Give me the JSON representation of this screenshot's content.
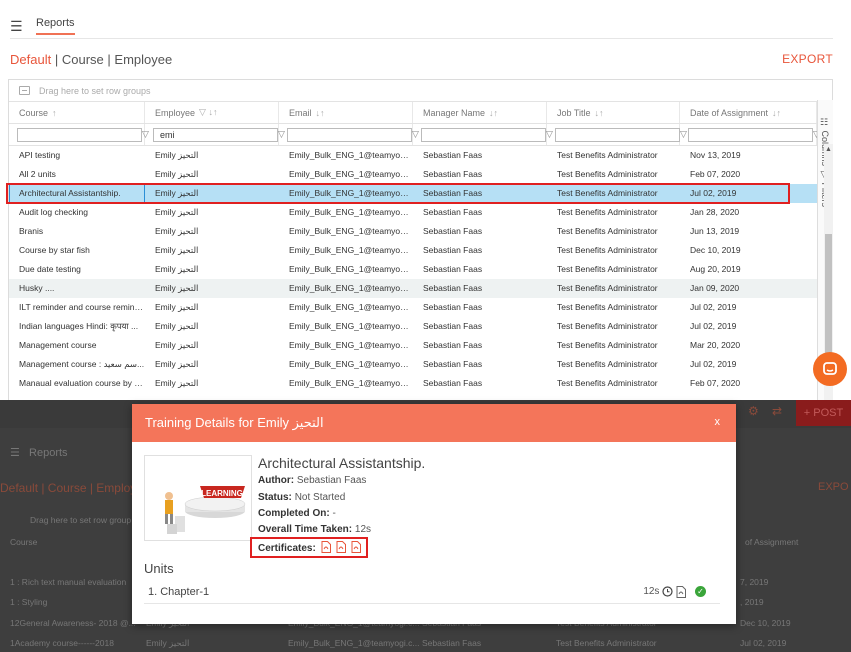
{
  "header": {
    "title": "Reports"
  },
  "breadcrumb": {
    "active": "Default",
    "sep1": "|",
    "course": "Course",
    "sep2": "|",
    "employee": "Employee"
  },
  "export_label": "EXPORT",
  "grid": {
    "group_hint": "Drag here to set row groups",
    "columns": [
      {
        "label": "Course",
        "sort": "↑"
      },
      {
        "label": "Employee",
        "sort": "▽ ↓↑"
      },
      {
        "label": "Email",
        "sort": "↓↑"
      },
      {
        "label": "Manager Name",
        "sort": "↓↑"
      },
      {
        "label": "Job Title",
        "sort": "↓↑"
      },
      {
        "label": "Date of Assignment",
        "sort": "↓↑"
      }
    ],
    "filters": [
      "",
      "emi",
      "",
      "",
      "",
      ""
    ],
    "rows": [
      [
        "API testing",
        "Emily التحيز",
        "Emily_Bulk_ENG_1@teamyogi.c...",
        "Sebastian Faas",
        "Test Benefits Administrator",
        "Nov 13, 2019"
      ],
      [
        "All 2 units",
        "Emily التحيز",
        "Emily_Bulk_ENG_1@teamyogi.c...",
        "Sebastian Faas",
        "Test Benefits Administrator",
        "Feb 07, 2020"
      ],
      [
        "Architectural Assistantship.",
        "Emily التحيز",
        "Emily_Bulk_ENG_1@teamyogi.c...",
        "Sebastian Faas",
        "Test Benefits Administrator",
        "Jul 02, 2019"
      ],
      [
        "Audit log checking",
        "Emily التحيز",
        "Emily_Bulk_ENG_1@teamyogi.c...",
        "Sebastian Faas",
        "Test Benefits Administrator",
        "Jan 28, 2020"
      ],
      [
        "Branis",
        "Emily التحيز",
        "Emily_Bulk_ENG_1@teamyogi.c...",
        "Sebastian Faas",
        "Test Benefits Administrator",
        "Jun 13, 2019"
      ],
      [
        "Course by star fish",
        "Emily التحيز",
        "Emily_Bulk_ENG_1@teamyogi.c...",
        "Sebastian Faas",
        "Test Benefits Administrator",
        "Dec 10, 2019"
      ],
      [
        "Due date testing",
        "Emily التحيز",
        "Emily_Bulk_ENG_1@teamyogi.c...",
        "Sebastian Faas",
        "Test Benefits Administrator",
        "Aug 20, 2019"
      ],
      [
        "Husky ....",
        "Emily التحيز",
        "Emily_Bulk_ENG_1@teamyogi.c...",
        "Sebastian Faas",
        "Test Benefits Administrator",
        "Jan 09, 2020"
      ],
      [
        "ILT reminder and course remind...",
        "Emily التحيز",
        "Emily_Bulk_ENG_1@teamyogi.c...",
        "Sebastian Faas",
        "Test Benefits Administrator",
        "Jul 02, 2019"
      ],
      [
        "Indian languages Hindi: कृपया ...",
        "Emily التحيز",
        "Emily_Bulk_ENG_1@teamyogi.c...",
        "Sebastian Faas",
        "Test Benefits Administrator",
        "Jul 02, 2019"
      ],
      [
        "Management course",
        "Emily التحيز",
        "Emily_Bulk_ENG_1@teamyogi.c...",
        "Sebastian Faas",
        "Test Benefits Administrator",
        "Mar 20, 2020"
      ],
      [
        "Management course : سم سعيد...",
        "Emily التحيز",
        "Emily_Bulk_ENG_1@teamyogi.c...",
        "Sebastian Faas",
        "Test Benefits Administrator",
        "Jul 02, 2019"
      ],
      [
        "Manaual evaluation course by s...",
        "Emily التحيز",
        "Emily_Bulk_ENG_1@teamyogi.c...",
        "Sebastian Faas",
        "Test Benefits Administrator",
        "Feb 07, 2020"
      ]
    ],
    "selected_row": 2,
    "hover_row": 7,
    "side_tabs": {
      "columns": "Columns",
      "filters": "Filters"
    }
  },
  "background": {
    "header_title": "Reports",
    "crumb": "Default | Course | Employe",
    "export": "EXPO",
    "group_hint": "Drag here to set row group",
    "course_header": "Course",
    "date_header": "of Assignment",
    "post_label": "+ POST",
    "rows": [
      [
        "1 : Rich text manual evaluation",
        "",
        "",
        "",
        "",
        "7, 2019"
      ],
      [
        "1 : Styling",
        "",
        "",
        "",
        "",
        ", 2019"
      ],
      [
        "12General Awareness- 2018 @...",
        "Emily التحيز",
        "Emily_Bulk_ENG_1@teamyogi.c...",
        "Sebastian Faas",
        "Test Benefits Administrator",
        "Dec 10, 2019"
      ],
      [
        "1Academy course------2018",
        "Emily التحيز",
        "Emily_Bulk_ENG_1@teamyogi.c...",
        "Sebastian Faas",
        "Test Benefits Administrator",
        "Jul 02, 2019"
      ]
    ]
  },
  "modal": {
    "title": "Training Details for Emily التحيز",
    "close": "x",
    "thumbnail_text": "LEARNING",
    "course_title": "Architectural Assistantship.",
    "author_label": "Author:",
    "author": "Sebastian Faas",
    "status_label": "Status:",
    "status": "Not Started",
    "completed_label": "Completed On:",
    "completed": "-",
    "time_label": "Overall Time Taken:",
    "time": "12s",
    "certificates_label": "Certificates:",
    "units_heading": "Units",
    "units": [
      {
        "name": "1. Chapter-1",
        "time": "12s"
      }
    ]
  },
  "colors": {
    "accent": "#e8553a",
    "modal_header": "#f4755a",
    "selection": "#b6e0f5",
    "highlight_box": "#e02020"
  }
}
